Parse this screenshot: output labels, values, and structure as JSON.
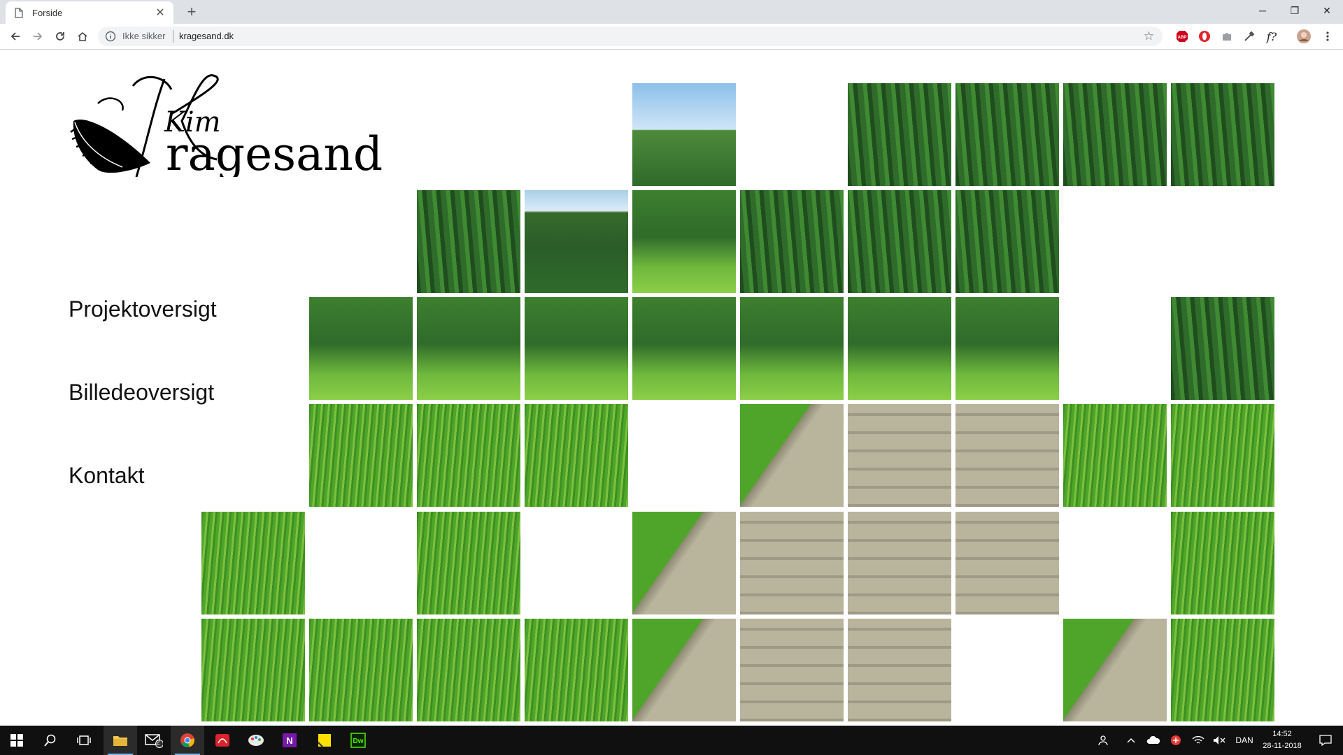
{
  "browser": {
    "tab_title": "Forside",
    "new_tab_symbol": "+",
    "close_symbol": "✕",
    "window_controls": {
      "minimize": "─",
      "restore": "❐",
      "close": "✕"
    },
    "security_label": "Ikke sikker",
    "url": "kragesand.dk",
    "extensions": [
      "abp-icon",
      "opera-icon",
      "puzzle-icon",
      "eyedropper-icon",
      "whatfont-icon",
      "profile-avatar",
      "menu-icon"
    ]
  },
  "site": {
    "logo_line1": "Kim",
    "logo_line2": "ragesand",
    "nav": [
      "Projektoversigt",
      "Billedeoversigt",
      "Kontakt"
    ]
  },
  "colors": {
    "accent_taskbar": "#76b9ed",
    "grass": "#4fa52a",
    "forest": "#2f6b2a",
    "sky": "#8cc0ea",
    "boardwalk": "#b9b49c"
  },
  "taskbar": {
    "pinned": [
      "start-icon",
      "search-icon",
      "task-view-icon",
      "file-explorer-icon",
      "mail-icon",
      "chrome-icon",
      "acrobat-icon",
      "paint-icon",
      "onenote-icon",
      "sticky-notes-icon",
      "dreamweaver-icon"
    ],
    "mail_badge": "2",
    "dreamweaver_label": "Dw",
    "onenote_label": "N",
    "language": "DAN",
    "time": "14:52",
    "date": "28-11-2018"
  }
}
